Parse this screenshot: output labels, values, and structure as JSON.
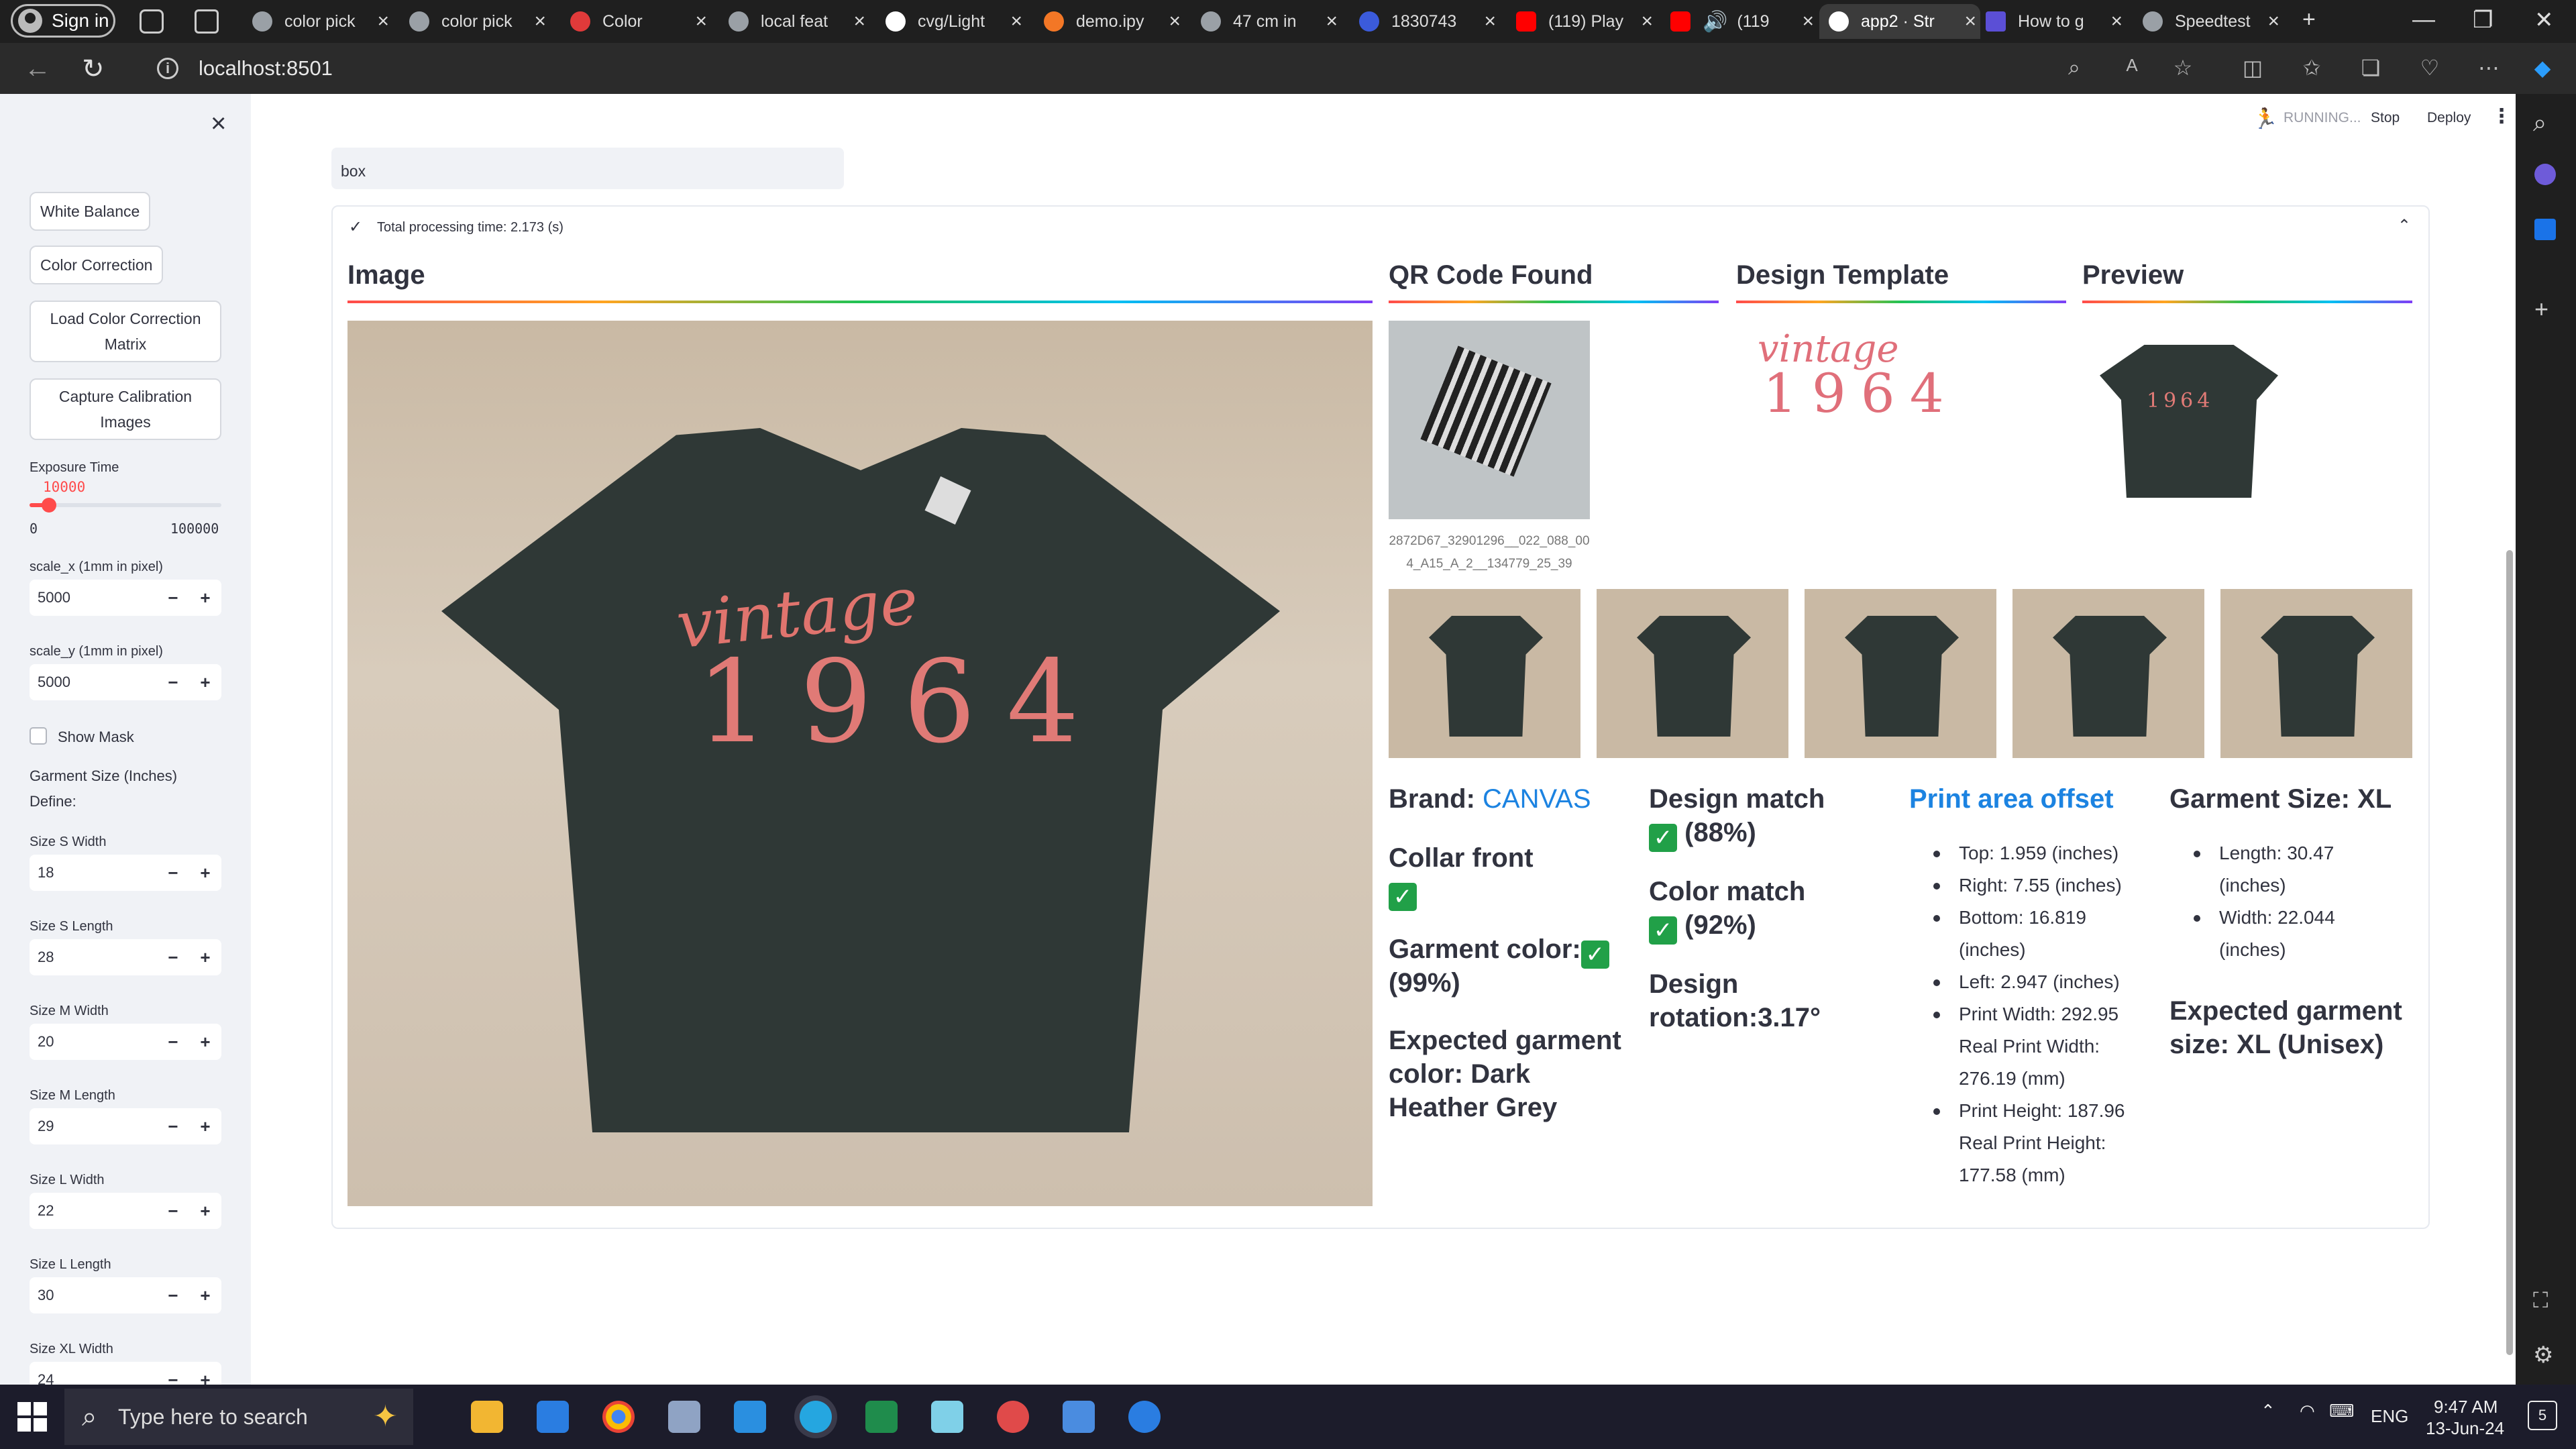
{
  "browser": {
    "signin_label": "Sign in",
    "tabs": [
      {
        "label": "color pick",
        "color": "#9aa0a6"
      },
      {
        "label": "color pick",
        "color": "#9aa0a6"
      },
      {
        "label": "Color",
        "color": "#e03a3a"
      },
      {
        "label": "local feat",
        "color": "#9aa0a6"
      },
      {
        "label": "cvg/Light",
        "color": "#ffffff"
      },
      {
        "label": "demo.ipy",
        "color": "#f37726"
      },
      {
        "label": "47 cm in",
        "color": "#9aa0a6"
      },
      {
        "label": "1830743",
        "color": "#3b5bdb"
      },
      {
        "label": "(119) Play",
        "color": "#ff0000"
      },
      {
        "label": "(119",
        "color": "#ff0000"
      },
      {
        "label": "app2 · Str",
        "color": "#ffffff"
      },
      {
        "label": "How to g",
        "color": "#5b4fd6"
      },
      {
        "label": "Speedtest",
        "color": "#9aa0a6"
      }
    ],
    "url": "localhost:8501"
  },
  "sidebar": {
    "buttons": {
      "white_balance": "White Balance",
      "color_correction": "Color Correction",
      "load_ccm": "Load Color Correction Matrix",
      "capture_calib": "Capture Calibration Images"
    },
    "exposure": {
      "label": "Exposure Time",
      "value": "10000",
      "min": "0",
      "max": "100000",
      "fraction": 0.1
    },
    "scale_x": {
      "label": "scale_x (1mm in pixel)",
      "value": "5000"
    },
    "scale_y": {
      "label": "scale_y (1mm in pixel)",
      "value": "5000"
    },
    "show_mask": "Show Mask",
    "garment_size_title": "Garment Size (Inches)",
    "define": "Define:",
    "sizes": [
      {
        "label": "Size S Width",
        "value": "18"
      },
      {
        "label": "Size S Length",
        "value": "28"
      },
      {
        "label": "Size M Width",
        "value": "20"
      },
      {
        "label": "Size M Length",
        "value": "29"
      },
      {
        "label": "Size L Width",
        "value": "22"
      },
      {
        "label": "Size L Length",
        "value": "30"
      },
      {
        "label": "Size XL Width",
        "value": "24"
      }
    ]
  },
  "header": {
    "running": "RUNNING...",
    "stop": "Stop",
    "deploy": "Deploy"
  },
  "main": {
    "search_value": "box",
    "status": "Total processing time: 2.173 (s)",
    "col_image": "Image",
    "col_qr": "QR Code Found",
    "col_template": "Design Template",
    "col_preview": "Preview",
    "qr_caption": "2872D67_32901296__022_088_004_A15_A_2__134779_25_39",
    "design_text_1": "vintage",
    "design_text_2": "1964",
    "brand_label": "Brand:",
    "brand_value": "CANVAS",
    "collar": "Collar front",
    "garment_color_label": "Garment color:",
    "garment_color_pct": "(99%)",
    "expected_color": "Expected garment color: Dark Heather Grey",
    "design_match": "Design match",
    "design_match_pct": "(88%)",
    "color_match": "Color match",
    "color_match_pct": "(92%)",
    "rotation": "Design rotation:3.17°",
    "print_area_title": "Print area offset",
    "print_area": [
      "Top: 1.959 (inches)",
      "Right: 7.55 (inches)",
      "Bottom: 16.819 (inches)",
      "Left: 2.947 (inches)",
      "Print Width: 292.95 Real Print Width: 276.19 (mm)",
      "Print Height: 187.96 Real Print Height: 177.58 (mm)"
    ],
    "garment_size_title": "Garment Size: XL",
    "garment_size": [
      "Length: 30.47 (inches)",
      "Width: 22.044 (inches)"
    ],
    "expected_size": "Expected garment size: XL (Unisex)"
  },
  "taskbar": {
    "search_placeholder": "Type here to search",
    "time": "9:47 AM",
    "date": "13-Jun-24",
    "lang": "ENG",
    "notif_count": "5"
  },
  "colors": {
    "accent": "#ff4b4b",
    "link": "#1c83e1",
    "ok": "#21a048",
    "shirt": "#2f3836",
    "wood": "#c9b9a4"
  }
}
